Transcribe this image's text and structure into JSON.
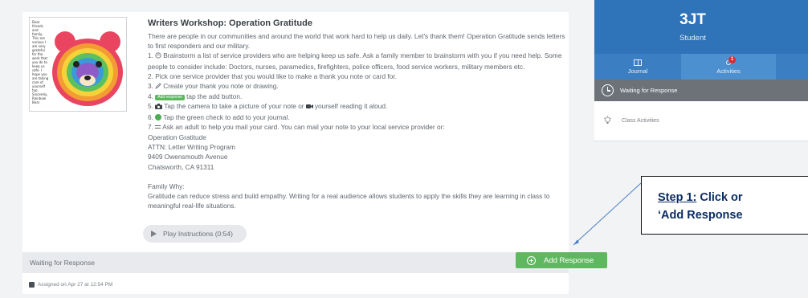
{
  "activity": {
    "title": "Writers Workshop: Operation Gratitude",
    "thumbnail_text": "Dear friends and family, This are various I am very grateful for the work that you do to keep us safe. I hope you are taking care of yourself too. Sincerely, Rainbow Bear",
    "lines": [
      "There are people in our communities and around the world that work hard to help us daily. Let's thank them! Operation Gratitude sends letters",
      "to first responders and our military.",
      "Brainstorm a list of service providers who are helping keep us safe. Ask a family member to brainstorm with you if you need help. Some",
      "people to consider include: Doctors, nurses, paramedics, firefighters, police officers, food service workers, military members etc.",
      "2. Pick one service provider that you would like to make a thank you note or card for.",
      "Create your thank you note or drawing.",
      "tap the add button.",
      "Tap the camera to take a picture of your note or",
      "yourself reading it aloud.",
      "Tap the green check to add to your journal.",
      "Ask an adult to help you mail your card. You can mail your note to your local service provider or:",
      "Operation Gratitude",
      "ATTN: Letter Writing Program",
      "9409 Owensmouth Avenue",
      "Chatsworth, CA 91311",
      "Family Why:",
      "Gratitude can reduce stress and build empathy. Writing for a real audience allows students to apply the skills they are learning in class to",
      "meaningful real-life situations."
    ],
    "num_1": "1.",
    "num_3": "3.",
    "num_4": "4.",
    "num_5": "5.",
    "num_6": "6.",
    "num_7": "7.",
    "add_response_tag": "Add response",
    "play_label": "Play Instructions (0:54)",
    "response_status": "Waiting for Response",
    "add_response_label": "Add Response",
    "assigned": "Assigned on Apr 27 at 12:54 PM"
  },
  "panel": {
    "name": "3JT",
    "role": "Student",
    "tabs": [
      {
        "label": "Journal",
        "icon": "book-icon"
      },
      {
        "label": "Activities",
        "icon": "lightbulb-icon",
        "badge": "1"
      }
    ],
    "waiting_label": "Waiting for Response",
    "class_label": "Class Activities"
  },
  "callout": {
    "line1_prefix": "Step 1:",
    "line1_rest": " Click or",
    "line2": "‘Add Response"
  },
  "colors": {
    "header_blue": "#2f73b8",
    "accent_green": "#5fb85f",
    "badge_red": "#e0292f",
    "callout_text": "#0d2c63"
  }
}
